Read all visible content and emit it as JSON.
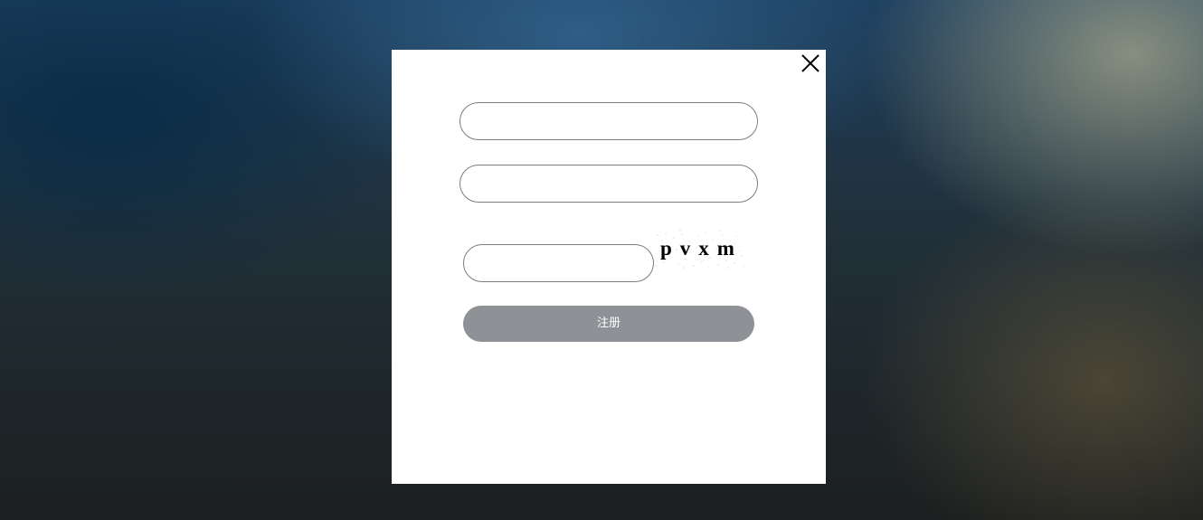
{
  "background": {
    "colors": [
      "#1d3f5f",
      "#213039",
      "#1c1f1f",
      "#aaaa8c"
    ]
  },
  "modal": {
    "background_color": "#ffffff",
    "close_icon": "close-icon",
    "fields": {
      "username": {
        "value": "",
        "placeholder": ""
      },
      "password": {
        "value": "",
        "placeholder": ""
      },
      "captcha_input": {
        "value": "",
        "placeholder": ""
      }
    },
    "captcha": {
      "text": "pvxm"
    },
    "submit": {
      "label": "注册",
      "color": "#8e9195"
    }
  }
}
